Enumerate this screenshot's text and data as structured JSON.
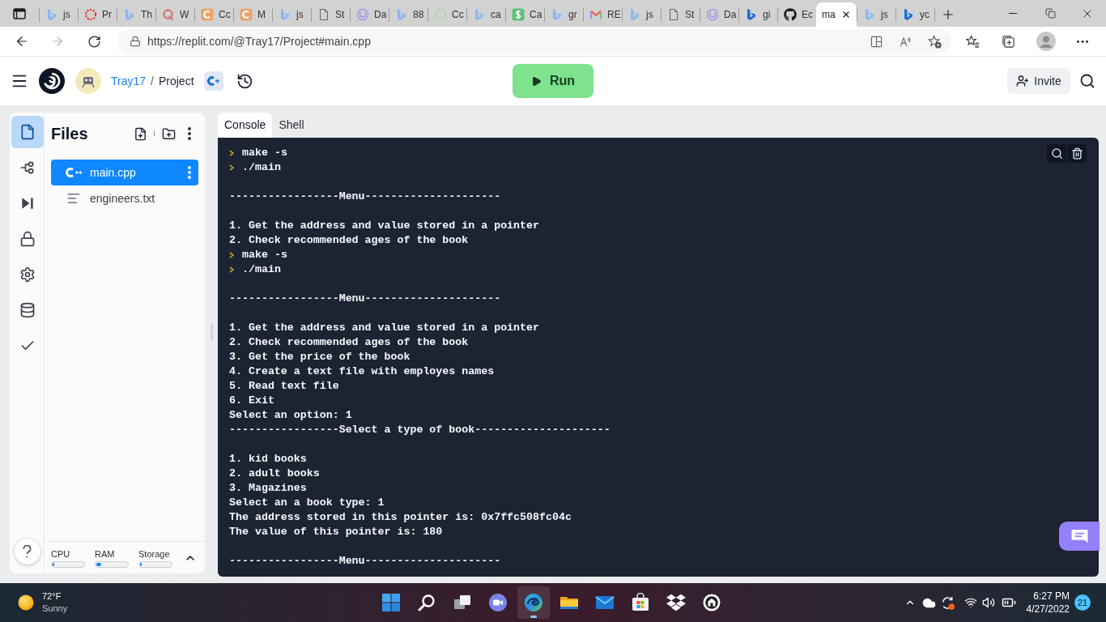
{
  "browser": {
    "tabs": [
      {
        "kind": "bing",
        "label": "js",
        "selected": false
      },
      {
        "kind": "red-ring",
        "label": "Pr",
        "selected": false
      },
      {
        "kind": "bing",
        "label": "Th",
        "selected": false
      },
      {
        "kind": "quora",
        "label": "W",
        "selected": false
      },
      {
        "kind": "orange-c",
        "label": "Cc",
        "selected": false
      },
      {
        "kind": "orange-c",
        "label": "M",
        "selected": false
      },
      {
        "kind": "bing",
        "label": "js",
        "selected": false
      },
      {
        "kind": "page",
        "label": "St",
        "selected": false
      },
      {
        "kind": "purple-ring",
        "label": "Da",
        "selected": false
      },
      {
        "kind": "bing",
        "label": "88",
        "selected": false
      },
      {
        "kind": "green-ring",
        "label": "Cc",
        "selected": false
      },
      {
        "kind": "bing",
        "label": "ca",
        "selected": false
      },
      {
        "kind": "dollar",
        "label": "Ca",
        "selected": false
      },
      {
        "kind": "bing",
        "label": "gr",
        "selected": false
      },
      {
        "kind": "gmail",
        "label": "RE",
        "selected": false
      },
      {
        "kind": "bing",
        "label": "js",
        "selected": false
      },
      {
        "kind": "page",
        "label": "St",
        "selected": false
      },
      {
        "kind": "purple-ring",
        "label": "Da",
        "selected": false
      },
      {
        "kind": "bing-dark",
        "label": "gi",
        "selected": false
      },
      {
        "kind": "github",
        "label": "Ec",
        "selected": false
      },
      {
        "kind": "none",
        "label": "ma",
        "selected": true
      },
      {
        "kind": "bing",
        "label": "js",
        "selected": false
      },
      {
        "kind": "bing-dark",
        "label": "yc",
        "selected": false
      }
    ],
    "address": "https://replit.com/@Tray17/Project#main.cpp"
  },
  "header": {
    "user": "Tray17",
    "separator": "/",
    "project": "Project",
    "run": "Run",
    "invite": "Invite"
  },
  "sidebar": {
    "nav": [
      {
        "kind": "files",
        "selected": true
      },
      {
        "kind": "git",
        "selected": false
      },
      {
        "kind": "debugger",
        "selected": false
      },
      {
        "kind": "secrets",
        "selected": false
      },
      {
        "kind": "settings",
        "selected": false
      },
      {
        "kind": "database",
        "selected": false
      },
      {
        "kind": "tests",
        "selected": false
      }
    ]
  },
  "files": {
    "title": "Files",
    "items": [
      {
        "name": "main.cpp",
        "kind": "cpp",
        "selected": true
      },
      {
        "name": "engineers.txt",
        "kind": "text",
        "selected": false
      }
    ],
    "resources": [
      {
        "label": "CPU",
        "level": 0.05
      },
      {
        "label": "RAM",
        "level": 0.15
      },
      {
        "label": "Storage",
        "level": 0.05
      }
    ]
  },
  "console": {
    "tabs": [
      {
        "label": "Console",
        "selected": true
      },
      {
        "label": "Shell",
        "selected": false
      }
    ],
    "lines": [
      {
        "kind": "prompt",
        "text": "make -s"
      },
      {
        "kind": "prompt",
        "text": "./main"
      },
      {
        "kind": "blank"
      },
      {
        "kind": "output",
        "text": "-----------------Menu---------------------"
      },
      {
        "kind": "blank"
      },
      {
        "kind": "output",
        "text": "1. Get the address and value stored in a pointer"
      },
      {
        "kind": "output",
        "text": "2. Check recommended ages of the book"
      },
      {
        "kind": "prompt",
        "text": "make -s"
      },
      {
        "kind": "prompt",
        "text": "./main"
      },
      {
        "kind": "blank"
      },
      {
        "kind": "output",
        "text": "-----------------Menu---------------------"
      },
      {
        "kind": "blank"
      },
      {
        "kind": "output",
        "text": "1. Get the address and value stored in a pointer"
      },
      {
        "kind": "output",
        "text": "2. Check recommended ages of the book"
      },
      {
        "kind": "output",
        "text": "3. Get the price of the book"
      },
      {
        "kind": "output",
        "text": "4. Create a text file with employes names"
      },
      {
        "kind": "output",
        "text": "5. Read text file"
      },
      {
        "kind": "output",
        "text": "6. Exit"
      },
      {
        "kind": "output",
        "text": "Select an option: 1"
      },
      {
        "kind": "output",
        "text": "-----------------Select a type of book---------------------"
      },
      {
        "kind": "blank"
      },
      {
        "kind": "output",
        "text": "1. kid books"
      },
      {
        "kind": "output",
        "text": "2. adult books"
      },
      {
        "kind": "output",
        "text": "3. Magazines"
      },
      {
        "kind": "output",
        "text": "Select an a book type: 1"
      },
      {
        "kind": "output",
        "text": "The address stored in this pointer is: 0x7ffc508fc04c"
      },
      {
        "kind": "output",
        "text": "The value of this pointer is: 180"
      },
      {
        "kind": "blank"
      },
      {
        "kind": "output",
        "text": "-----------------Menu---------------------"
      }
    ]
  },
  "taskbar": {
    "weather": {
      "temperature": "72°F",
      "condition": "Sunny"
    },
    "apps": [
      {
        "kind": "start",
        "selected": false
      },
      {
        "kind": "search",
        "selected": false
      },
      {
        "kind": "task-view",
        "selected": false
      },
      {
        "kind": "chat",
        "selected": false
      },
      {
        "kind": "edge",
        "selected": true
      },
      {
        "kind": "explorer",
        "selected": false
      },
      {
        "kind": "mail",
        "selected": false
      },
      {
        "kind": "store",
        "selected": false
      },
      {
        "kind": "dropbox",
        "selected": false
      },
      {
        "kind": "app",
        "selected": false
      }
    ],
    "time": "6:27 PM",
    "date": "4/27/2022",
    "notifications": "21"
  }
}
